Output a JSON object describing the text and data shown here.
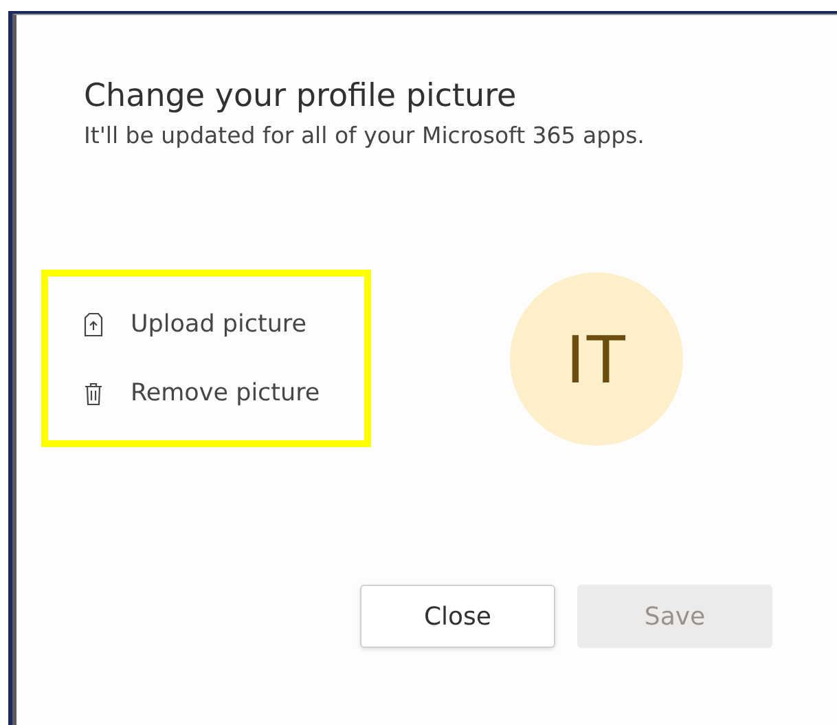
{
  "dialog": {
    "title": "Change your profile picture",
    "subtitle": "It'll be updated for all of your Microsoft 365 apps."
  },
  "actions": [
    {
      "kind": "upload",
      "label": "Upload picture"
    },
    {
      "kind": "remove",
      "label": "Remove picture"
    }
  ],
  "avatar": {
    "initials": "IT"
  },
  "buttons": [
    {
      "label": "Close",
      "disabled": false
    },
    {
      "label": "Save",
      "disabled": true
    }
  ]
}
